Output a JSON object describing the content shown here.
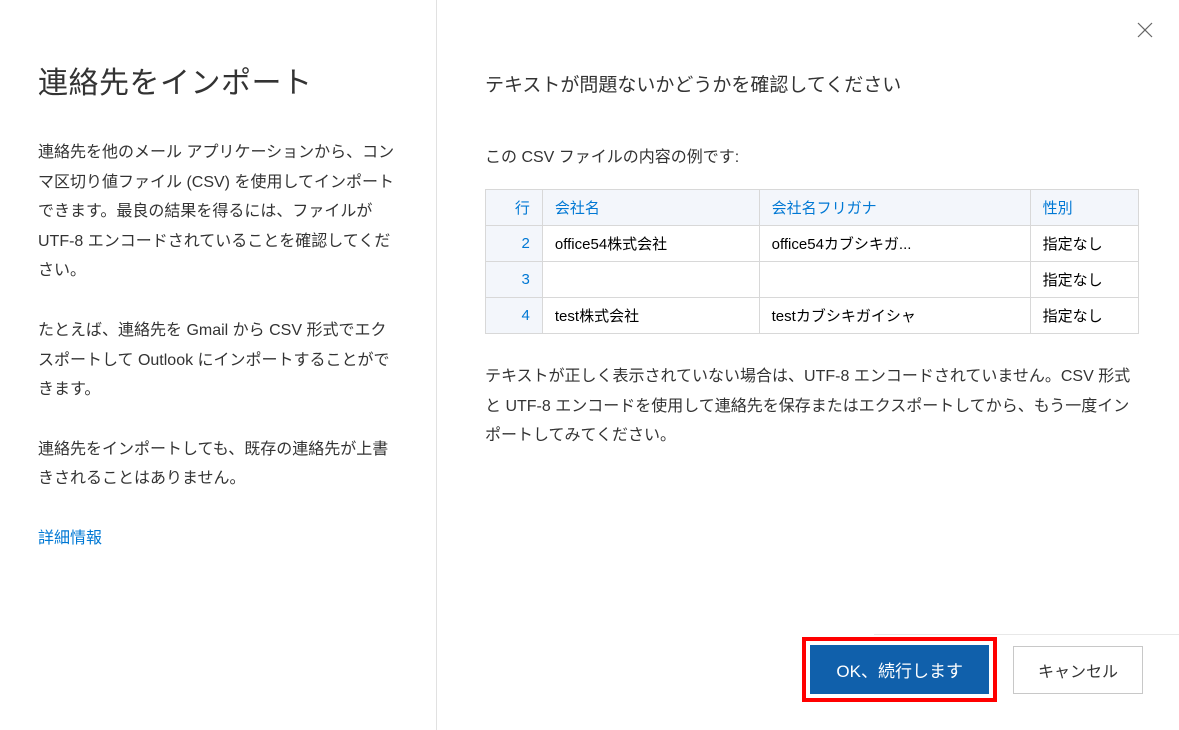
{
  "left": {
    "title": "連絡先をインポート",
    "paragraph1": "連絡先を他のメール アプリケーションから、コンマ区切り値ファイル (CSV) を使用してインポートできます。最良の結果を得るには、ファイルが UTF-8 エンコードされていることを確認してください。",
    "paragraph2": "たとえば、連絡先を Gmail から CSV 形式でエクスポートして Outlook にインポートすることができます。",
    "paragraph3": "連絡先をインポートしても、既存の連絡先が上書きされることはありません。",
    "info_link": "詳細情報"
  },
  "right": {
    "heading": "テキストが問題ないかどうかを確認してください",
    "subtext": "この CSV ファイルの内容の例です:",
    "table": {
      "headers": {
        "row": "行",
        "company": "会社名",
        "furigana": "会社名フリガナ",
        "gender": "性別"
      },
      "rows": [
        {
          "num": "2",
          "company": "office54株式会社",
          "furigana": "office54カブシキガ...",
          "gender": "指定なし"
        },
        {
          "num": "3",
          "company": "",
          "furigana": "",
          "gender": "指定なし"
        },
        {
          "num": "4",
          "company": "test株式会社",
          "furigana": "testカブシキガイシャ",
          "gender": "指定なし"
        }
      ]
    },
    "note": "テキストが正しく表示されていない場合は、UTF-8 エンコードされていません。CSV 形式と UTF-8 エンコードを使用して連絡先を保存またはエクスポートしてから、もう一度インポートしてみてください。"
  },
  "buttons": {
    "ok": "OK、続行します",
    "cancel": "キャンセル"
  },
  "colors": {
    "primary": "#1060ab",
    "link": "#0078d4",
    "annotation": "#ff0000"
  }
}
